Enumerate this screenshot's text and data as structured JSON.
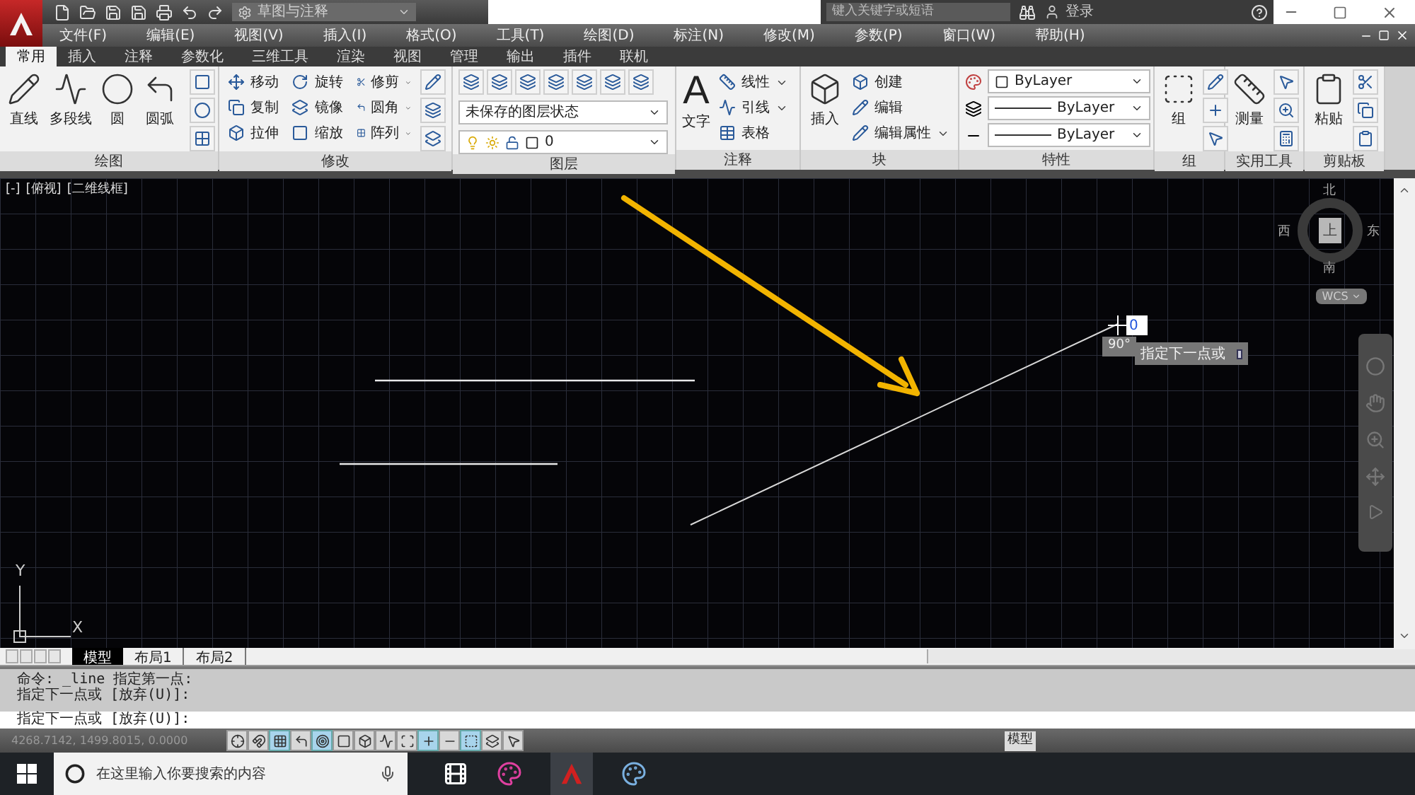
{
  "app": {
    "workspace": "草图与注释"
  },
  "search": {
    "placeholder": "键入关键字或短语"
  },
  "account": {
    "label": "登录"
  },
  "menu": [
    "文件(F)",
    "编辑(E)",
    "视图(V)",
    "插入(I)",
    "格式(O)",
    "工具(T)",
    "绘图(D)",
    "标注(N)",
    "修改(M)",
    "参数(P)",
    "窗口(W)",
    "帮助(H)"
  ],
  "ribbon_tabs": [
    {
      "label": "常用",
      "selected": true
    },
    {
      "label": "插入",
      "selected": false
    },
    {
      "label": "注释",
      "selected": false
    },
    {
      "label": "参数化",
      "selected": false
    },
    {
      "label": "三维工具",
      "selected": false
    },
    {
      "label": "渲染",
      "selected": false
    },
    {
      "label": "视图",
      "selected": false
    },
    {
      "label": "管理",
      "selected": false
    },
    {
      "label": "输出",
      "selected": false
    },
    {
      "label": "插件",
      "selected": false
    },
    {
      "label": "联机",
      "selected": false
    }
  ],
  "panels": {
    "draw": {
      "title": "绘图",
      "tools": [
        "直线",
        "多段线",
        "圆",
        "圆弧"
      ]
    },
    "modify": {
      "title": "修改",
      "tools": [
        {
          "label": "移动",
          "menu": false
        },
        {
          "label": "旋转",
          "menu": false
        },
        {
          "label": "修剪",
          "menu": true
        },
        {
          "label": "复制",
          "menu": false
        },
        {
          "label": "镜像",
          "menu": false
        },
        {
          "label": "圆角",
          "menu": true
        },
        {
          "label": "拉伸",
          "menu": false
        },
        {
          "label": "缩放",
          "menu": false
        },
        {
          "label": "阵列",
          "menu": true
        }
      ]
    },
    "layers": {
      "title": "图层",
      "layer_state": "未保存的图层状态",
      "current_layer": "0"
    },
    "annotation": {
      "title": "注释",
      "glyph": "A",
      "large": "文字",
      "tools": [
        {
          "label": "线性",
          "menu": true
        },
        {
          "label": "引线",
          "menu": true
        },
        {
          "label": "表格",
          "menu": false
        }
      ]
    },
    "block": {
      "title": "块",
      "large": "插入",
      "tools": [
        {
          "label": "创建",
          "menu": false
        },
        {
          "label": "编辑",
          "menu": false
        },
        {
          "label": "编辑属性",
          "menu": true
        }
      ]
    },
    "properties": {
      "title": "特性",
      "color_setting": "ByLayer",
      "linetype": "ByLayer",
      "lineweight": "ByLayer"
    },
    "groups": {
      "title": "组",
      "large": "组"
    },
    "utilities": {
      "title": "实用工具",
      "large": "测量"
    },
    "clipboard": {
      "title": "剪贴板",
      "large": "粘贴"
    }
  },
  "viewport": {
    "labels": [
      "[-]",
      "[俯视]",
      "[二维线框]"
    ],
    "viewcube": {
      "north": "北",
      "south": "南",
      "east": "东",
      "west": "西",
      "face": "上",
      "ucs": "WCS"
    },
    "dynamic_input": {
      "value": "0",
      "angle": "90°",
      "prompt": "指定下一点或"
    },
    "ucs_icon": {
      "x": "X",
      "y": "Y"
    }
  },
  "layout_tabs": [
    {
      "label": "模型",
      "selected": true
    },
    {
      "label": "布局1",
      "selected": false
    },
    {
      "label": "布局2",
      "selected": false
    }
  ],
  "command_line": {
    "history": [
      "命令: _line 指定第一点:",
      "指定下一点或 [放弃(U)]:"
    ],
    "prompt": "指定下一点或 [放弃(U)]:"
  },
  "status_bar": {
    "coordinates": "4268.7142, 1499.8015, 0.0000",
    "model": "模型",
    "toggles": [
      {
        "on": false
      },
      {
        "on": false
      },
      {
        "on": true
      },
      {
        "on": false
      },
      {
        "on": true
      },
      {
        "on": false
      },
      {
        "on": false
      },
      {
        "on": false
      },
      {
        "on": false
      },
      {
        "on": true
      },
      {
        "on": false
      },
      {
        "on": true
      },
      {
        "on": false
      },
      {
        "on": false
      }
    ]
  },
  "taskbar": {
    "search_placeholder": "在这里输入你要搜索的内容"
  }
}
